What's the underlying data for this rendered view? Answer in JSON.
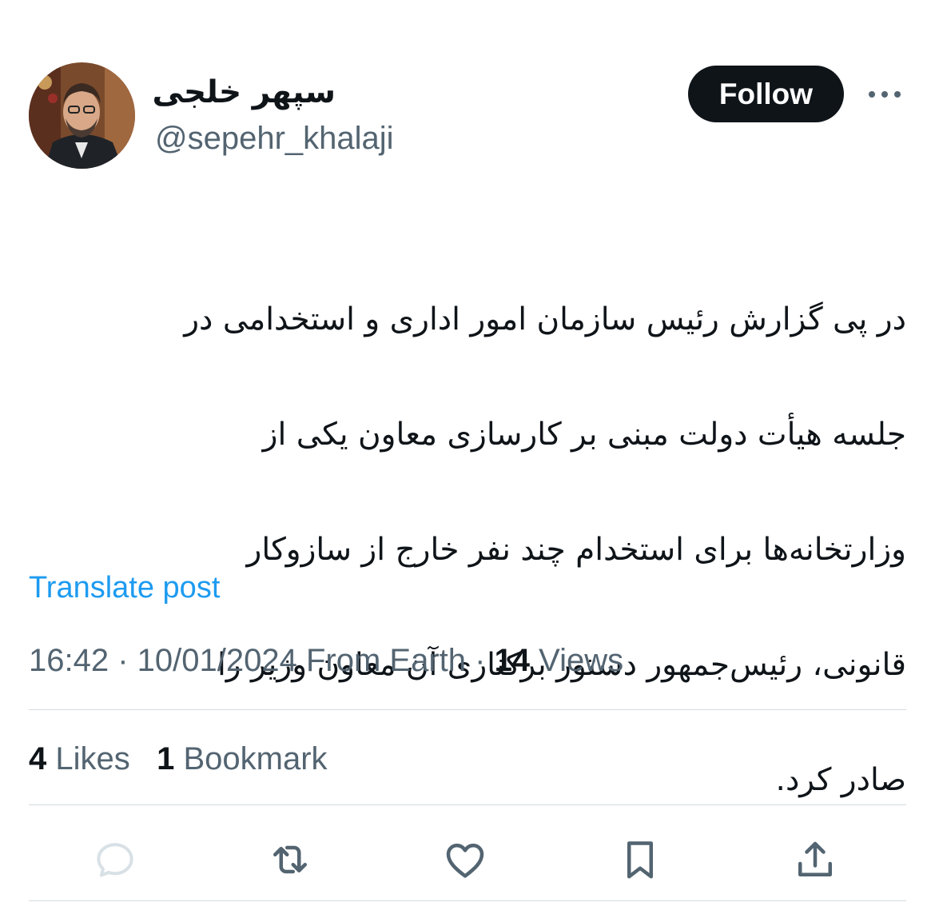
{
  "author": {
    "display_name": "سپهر خلجی",
    "handle": "@sepehr_khalaji"
  },
  "header": {
    "follow_label": "Follow",
    "more_icon": "more-horizontal-icon"
  },
  "post": {
    "text_lines": [
      "در پی گزارش رئیس سازمان امور اداری و استخدامی در",
      "جلسه هیأت دولت مبنی بر کارسازی معاون یکی از",
      "وزارتخانه‌ها برای استخدام چند نفر خارج از سازوکار",
      "قانونی، رئیس‌جمهور دستور برکناری آن معاون وزیر را",
      "صادر کرد."
    ],
    "translate_label": "Translate post"
  },
  "meta": {
    "time": "16:42",
    "sep1": " · ",
    "date": "10/01/2024",
    "location": " From Earth",
    "sep2": " · ",
    "views_count": "14",
    "views_label": " Views"
  },
  "stats": {
    "likes_count": "4",
    "likes_label": " Likes",
    "bookmarks_count": "1",
    "bookmarks_label": " Bookmark"
  },
  "actions": [
    {
      "name": "reply",
      "icon": "reply-icon"
    },
    {
      "name": "repost",
      "icon": "repost-icon"
    },
    {
      "name": "like",
      "icon": "heart-icon"
    },
    {
      "name": "bookmark",
      "icon": "bookmark-icon"
    },
    {
      "name": "share",
      "icon": "share-icon"
    }
  ],
  "colors": {
    "text": "#0f1419",
    "secondary": "#536471",
    "link": "#1d9bf0",
    "divider": "#d3dbe0"
  }
}
